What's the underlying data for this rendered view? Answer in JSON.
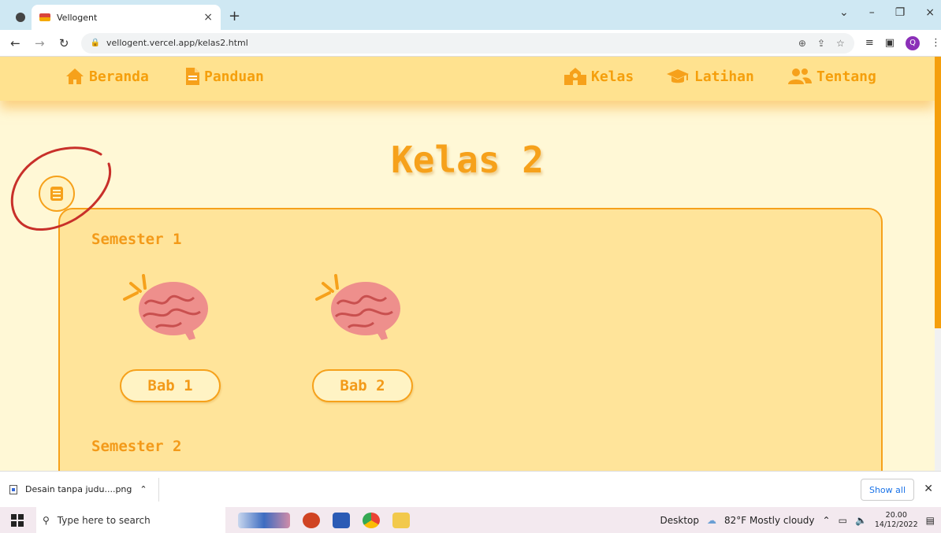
{
  "browser": {
    "tab_title": "Vellogent",
    "tab_close": "×",
    "new_tab": "+",
    "url": "vellogent.vercel.app/kelas2.html",
    "window_controls": [
      "⌄",
      "–",
      "❐",
      "×"
    ],
    "profile_initial": "Q"
  },
  "nav": {
    "beranda": "Beranda",
    "panduan": "Panduan",
    "kelas": "Kelas",
    "latihan": "Latihan",
    "tentang": "Tentang"
  },
  "page": {
    "title": "Kelas 2",
    "semester1": {
      "label": "Semester 1",
      "chapters": [
        "Bab 1",
        "Bab 2"
      ]
    },
    "semester2": {
      "label": "Semester 2"
    }
  },
  "downloads": {
    "file_name": "Desain tanpa judu....png",
    "show_all": "Show all"
  },
  "taskbar": {
    "search_placeholder": "Type here to search",
    "desktop_label": "Desktop",
    "weather": "82°F  Mostly cloudy",
    "time": "20.00",
    "date": "14/12/2022"
  },
  "colors": {
    "accent": "#f6a11b",
    "navbar_bg": "#ffe28f",
    "page_bg": "#fff8d6",
    "card_bg": "#ffe49a",
    "annotation_red": "#c8302a"
  }
}
